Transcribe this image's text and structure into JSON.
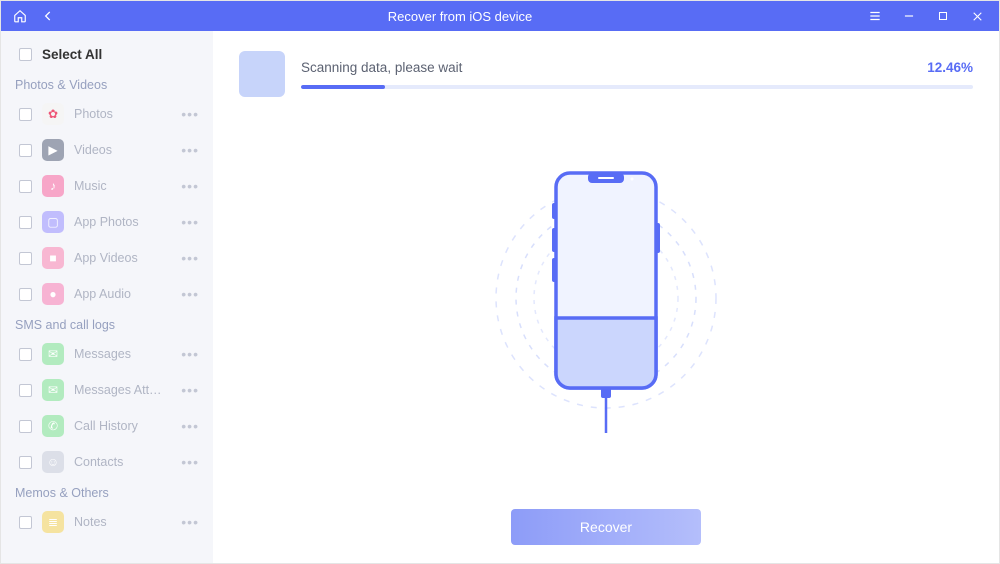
{
  "title": "Recover from iOS device",
  "selectAll": "Select All",
  "scanning": {
    "text": "Scanning data, please wait",
    "percent": "12.46%",
    "percentValue": 12.46
  },
  "recoverLabel": "Recover",
  "sections": [
    {
      "title": "Photos & Videos",
      "items": [
        {
          "label": "Photos",
          "color": "#f5f5f5",
          "glyph": "✿"
        },
        {
          "label": "Videos",
          "color": "#9ea4b3",
          "glyph": "▶"
        },
        {
          "label": "Music",
          "color": "#f7a6c8",
          "glyph": "♪"
        },
        {
          "label": "App Photos",
          "color": "#c1bdfd",
          "glyph": "▢"
        },
        {
          "label": "App Videos",
          "color": "#f8b7d2",
          "glyph": "■"
        },
        {
          "label": "App Audio",
          "color": "#f7b3d3",
          "glyph": "●"
        }
      ]
    },
    {
      "title": "SMS and call logs",
      "items": [
        {
          "label": "Messages",
          "color": "#b2ebbf",
          "glyph": "✉"
        },
        {
          "label": "Messages Attachments",
          "color": "#b2ebbf",
          "glyph": "✉"
        },
        {
          "label": "Call History",
          "color": "#b2ebbf",
          "glyph": "✆"
        },
        {
          "label": "Contacts",
          "color": "#dcdfe8",
          "glyph": "☺"
        }
      ]
    },
    {
      "title": "Memos & Others",
      "items": [
        {
          "label": "Notes",
          "color": "#f5e3a0",
          "glyph": "≣"
        }
      ]
    }
  ]
}
